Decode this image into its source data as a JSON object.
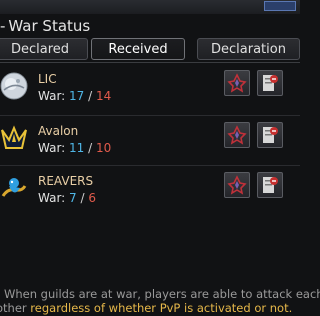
{
  "window": {
    "title": "War Status"
  },
  "tabs": [
    {
      "label": "Declared"
    },
    {
      "label": "Received"
    }
  ],
  "declaration_button": {
    "label": "Declaration"
  },
  "war_label": "War:",
  "guilds": [
    {
      "name": "LIC",
      "war_a": "17",
      "war_b": "14",
      "emblem": "moon-emblem-icon"
    },
    {
      "name": "Avalon",
      "war_a": "11",
      "war_b": "10",
      "emblem": "crown-emblem-icon"
    },
    {
      "name": "REAVERS",
      "war_a": "7",
      "war_b": "6",
      "emblem": "genie-emblem-icon"
    }
  ],
  "info": {
    "line1": "When guilds are at war, players are able to attack each",
    "line2_prefix": "other ",
    "line2_highlight": "regardless of whether PvP is activated or not."
  },
  "colors": {
    "guild_name": "#e9cfa6",
    "war_count_a": "#4fb6e6",
    "war_count_b": "#e05a4b",
    "highlight": "#e6b84a"
  }
}
